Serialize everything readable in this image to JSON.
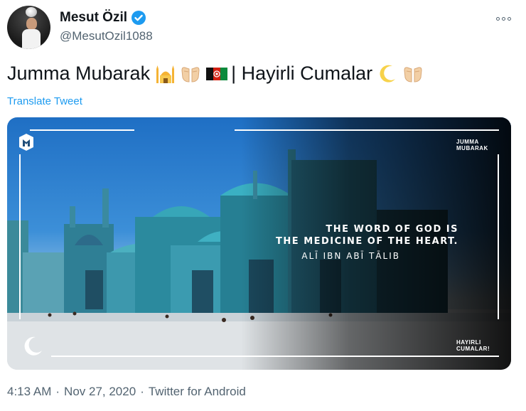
{
  "author": {
    "display_name": "Mesut Özil",
    "handle": "@MesutOzil1088",
    "verified": true
  },
  "tweet": {
    "text_part1": "Jumma Mubarak",
    "text_part2": "| Hayirli Cumalar",
    "emojis": [
      "mosque-emoji",
      "palms-up-emoji",
      "afghanistan-flag-emoji",
      "crescent-moon-emoji",
      "palms-up-emoji"
    ],
    "translate_label": "Translate Tweet"
  },
  "media": {
    "top_right_text_line1": "JUMMA",
    "top_right_text_line2": "MUBARAK",
    "quote_line1": "THE WORD OF GOD IS",
    "quote_line2": "THE MEDICINE OF THE HEART.",
    "quote_author": "ALĪ IBN ABĪ TĀLIB",
    "bottom_right_text_line1": "HAYIRLI",
    "bottom_right_text_line2": "CUMALAR!",
    "logo_icon": "m-logo-icon",
    "moon_icon": "crescent-moon-icon"
  },
  "meta": {
    "time": "4:13 AM",
    "separator": "·",
    "date": "Nov 27, 2020",
    "source": "Twitter for Android"
  },
  "colors": {
    "accent": "#1d9bf0",
    "secondary_text": "#536471"
  }
}
